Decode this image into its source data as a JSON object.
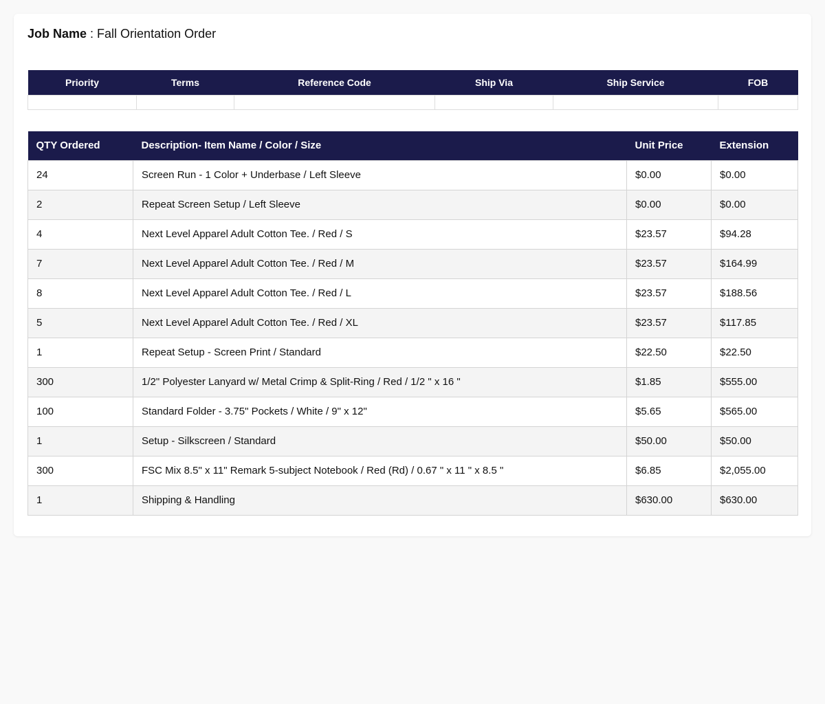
{
  "job": {
    "label": "Job Name",
    "separator": " : ",
    "value": "Fall Orientation Order"
  },
  "meta": {
    "headers": [
      "Priority",
      "Terms",
      "Reference Code",
      "Ship Via",
      "Ship Service",
      "FOB"
    ],
    "values": [
      "",
      "",
      "",
      "",
      "",
      ""
    ]
  },
  "items": {
    "headers": [
      "QTY Ordered",
      "Description- Item Name / Color / Size",
      "Unit Price",
      "Extension"
    ],
    "rows": [
      [
        "24",
        "Screen Run - 1 Color + Underbase / Left Sleeve",
        "$0.00",
        "$0.00"
      ],
      [
        "2",
        "Repeat Screen Setup / Left Sleeve",
        "$0.00",
        "$0.00"
      ],
      [
        "4",
        "Next Level Apparel Adult Cotton Tee. / Red / S",
        "$23.57",
        "$94.28"
      ],
      [
        "7",
        "Next Level Apparel Adult Cotton Tee. / Red / M",
        "$23.57",
        "$164.99"
      ],
      [
        "8",
        "Next Level Apparel Adult Cotton Tee. / Red / L",
        "$23.57",
        "$188.56"
      ],
      [
        "5",
        "Next Level Apparel Adult Cotton Tee. / Red / XL",
        "$23.57",
        "$117.85"
      ],
      [
        "1",
        "Repeat Setup - Screen Print / Standard",
        "$22.50",
        "$22.50"
      ],
      [
        "300",
        "1/2\" Polyester Lanyard w/ Metal Crimp & Split-Ring / Red / 1/2 \" x 16 \"",
        "$1.85",
        "$555.00"
      ],
      [
        "100",
        "Standard Folder - 3.75\" Pockets / White / 9\" x 12\"",
        "$5.65",
        "$565.00"
      ],
      [
        "1",
        "Setup - Silkscreen / Standard",
        "$50.00",
        "$50.00"
      ],
      [
        "300",
        "FSC Mix 8.5\" x 11\" Remark 5-subject Notebook / Red (Rd) / 0.67 \" x 11 \" x 8.5 \"",
        "$6.85",
        "$2,055.00"
      ],
      [
        "1",
        "Shipping & Handling",
        "$630.00",
        "$630.00"
      ]
    ]
  },
  "colors": {
    "header_bg": "#1b1b4b",
    "header_text": "#ffffff",
    "row_alt": "#f4f4f4"
  }
}
